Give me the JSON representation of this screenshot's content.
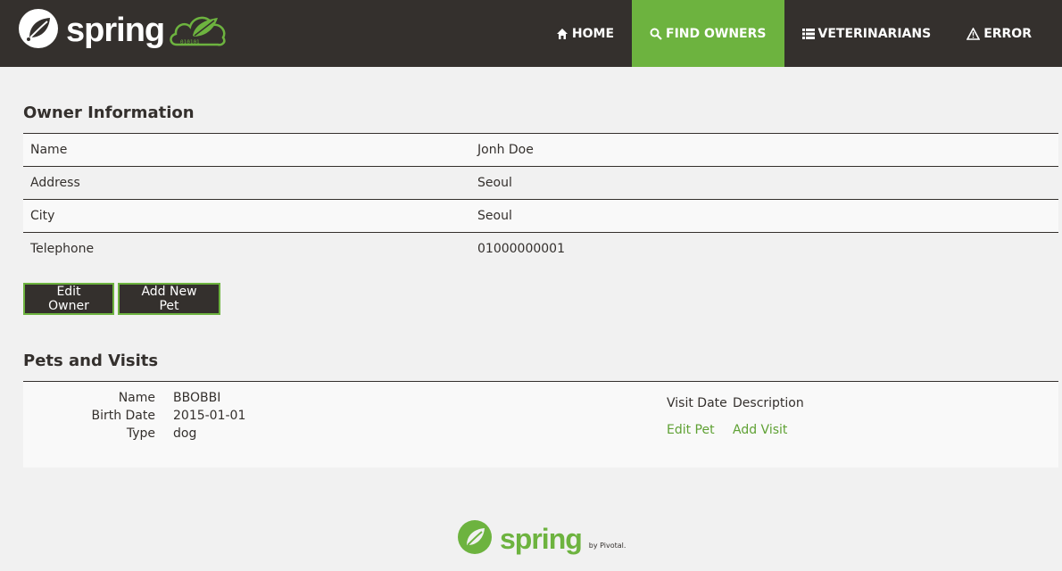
{
  "brand": {
    "wordmark": "spring",
    "cloud_code": "010101"
  },
  "nav": {
    "items": [
      {
        "label": "HOME",
        "icon": "home-icon"
      },
      {
        "label": "FIND OWNERS",
        "icon": "search-icon",
        "active": true
      },
      {
        "label": "VETERINARIANS",
        "icon": "list-icon"
      },
      {
        "label": "ERROR",
        "icon": "warning-icon"
      }
    ]
  },
  "owner": {
    "heading": "Owner Information",
    "rows": [
      {
        "label": "Name",
        "value": "Jonh Doe"
      },
      {
        "label": "Address",
        "value": "Seoul"
      },
      {
        "label": "City",
        "value": "Seoul"
      },
      {
        "label": "Telephone",
        "value": "01000000001"
      }
    ],
    "edit_label": "Edit Owner",
    "add_pet_label": "Add New Pet"
  },
  "pets": {
    "heading": "Pets and Visits",
    "pet": {
      "name_label": "Name",
      "name": "BBOBBI",
      "birth_label": "Birth Date",
      "birth": "2015-01-01",
      "type_label": "Type",
      "type": "dog"
    },
    "visits": {
      "col_date": "Visit Date",
      "col_desc": "Description",
      "edit_pet": "Edit Pet",
      "add_visit": "Add Visit"
    }
  },
  "footer": {
    "wordmark": "spring",
    "by": "by Pivotal."
  },
  "colors": {
    "dark": "#34302d",
    "accent": "#6db33f",
    "link": "#5fa134",
    "background": "#f1f1f1"
  }
}
